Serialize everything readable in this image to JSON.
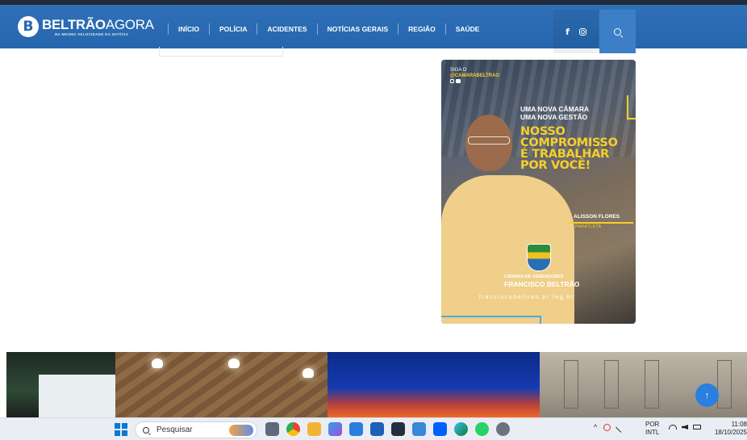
{
  "header": {
    "logo": {
      "bold": "BELTRÃO",
      "light": "AGORA",
      "tagline": "NA MESMA VELOCIDADE DA NOTÍCIA",
      "mark": "B"
    },
    "nav": [
      "INÍCIO",
      "POLÍCIA",
      "ACIDENTES",
      "NOTÍCIAS GERAIS",
      "REGIÃO",
      "SAÚDE"
    ],
    "social": {
      "facebook": "f"
    },
    "colors": {
      "header": "#2566ad",
      "search": "#3d7fc6"
    }
  },
  "ad": {
    "siga": "SIGA O",
    "handle": "@CAMARABELTRAO",
    "headline": [
      "UMA NOVA CÂMARA",
      "UMA NOVA GESTÃO"
    ],
    "slogan": [
      "NOSSO",
      "COMPROMISSO",
      "É TRABALHAR",
      "POR VOCÊ!"
    ],
    "name": "ALISSON FLORES",
    "role": "PARATLETA",
    "org_top": "CÂMARA DE VEREADORES",
    "org_bottom": "FRANCISCO BELTRÃO",
    "url": "franciscobeltrao.pr.leg.br",
    "colors": {
      "accent": "#f6cf2c",
      "line": "#4fa9e6"
    }
  },
  "back_to_top": {
    "glyph": "↑"
  },
  "taskbar": {
    "search_placeholder": "Pesquisar",
    "tray_caret": "^",
    "lang": [
      "POR",
      "INTL"
    ],
    "time": "11:08",
    "date": "18/10/2025",
    "icons": [
      "widgets-icon",
      "task-view-icon",
      "chrome-icon",
      "file-explorer-icon",
      "copilot-icon",
      "store-icon",
      "b-app-icon",
      "amazon-icon",
      "mail-icon",
      "dropbox-icon",
      "edge-icon",
      "whatsapp-icon",
      "settings-icon"
    ]
  }
}
